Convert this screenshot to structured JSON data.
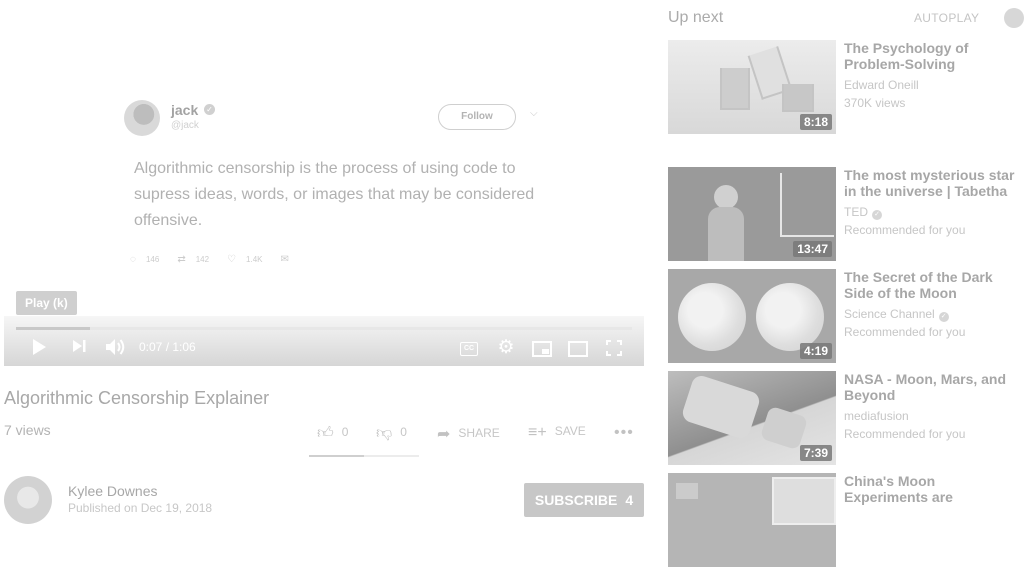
{
  "player": {
    "tweet": {
      "name": "jack",
      "handle": "@jack",
      "follow_label": "Follow",
      "text": "Algorithmic censorship is the process of using code to supress ideas, words, or images that may be considered offensive.",
      "replies": "146",
      "retweets": "142",
      "likes": "1.4K"
    },
    "tooltip": "Play (k)",
    "time": "0:07 / 1:06",
    "progress": 0.12
  },
  "video": {
    "title": "Algorithmic Censorship Explainer",
    "views": "7 views",
    "likes": "0",
    "dislikes": "0",
    "share_label": "SHARE",
    "save_label": "SAVE",
    "like_ratio": 0.5
  },
  "channel": {
    "name": "Kylee Downes",
    "published": "Published on Dec 19, 2018",
    "subscribe_label": "SUBSCRIBE",
    "subscriber_count": "4"
  },
  "sidebar": {
    "up_next_label": "Up next",
    "autoplay_label": "AUTOPLAY",
    "videos": [
      {
        "title": "The Psychology of Problem-Solving",
        "channel": "Edward Oneill",
        "meta": "370K views",
        "duration": "8:18",
        "verified": false
      },
      {
        "title": "The most mysterious star in the universe | Tabetha",
        "channel": "TED",
        "meta": "Recommended for you",
        "duration": "13:47",
        "verified": true
      },
      {
        "title": "The Secret of the Dark Side of the Moon",
        "channel": "Science Channel",
        "meta": "Recommended for you",
        "duration": "4:19",
        "verified": true
      },
      {
        "title": "NASA - Moon, Mars, and Beyond",
        "channel": "mediafusion",
        "meta": "Recommended for you",
        "duration": "7:39",
        "verified": false
      },
      {
        "title": "China's Moon Experiments are",
        "channel": "",
        "meta": "",
        "duration": "",
        "verified": false
      }
    ]
  },
  "colors": {
    "overlay_gray": "#9a9a9a",
    "subscribe_bg": "#c7c7c7"
  }
}
